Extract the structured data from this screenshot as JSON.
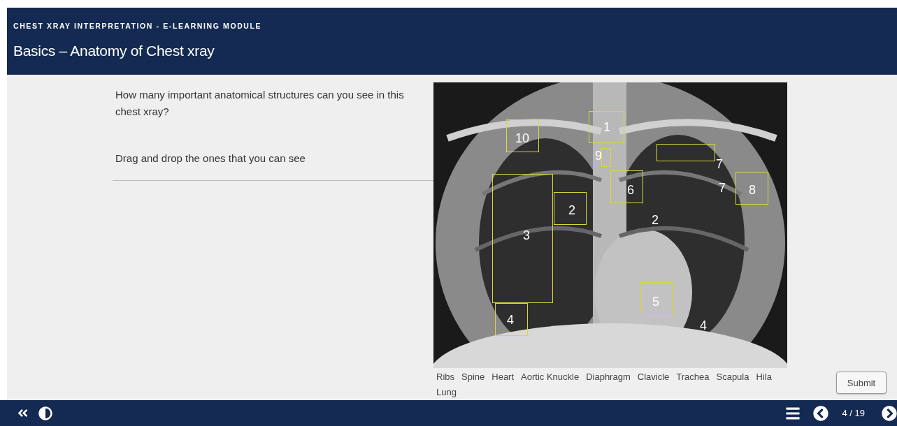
{
  "header": {
    "course_title": "CHEST XRAY INTERPRETATION - E-LEARNING MODULE",
    "slide_title": "Basics – Anatomy of Chest xray"
  },
  "question": {
    "prompt": "How many important anatomical structures can you see in this chest xray?",
    "instruction": "Drag and drop the ones that you can see"
  },
  "xray": {
    "kind": "picture",
    "markers": [
      "10",
      "1",
      "9",
      "7",
      "6",
      "7",
      "8",
      "2",
      "2",
      "3",
      "4",
      "5",
      "4"
    ]
  },
  "drag_items": [
    "Ribs",
    "Spine",
    "Heart",
    "Aortic Knuckle",
    "Diaphragm",
    "Clavicle",
    "Trachea",
    "Scapula",
    "Hila",
    "Lung"
  ],
  "submit_button": "Submit",
  "footer": {
    "page_indicator": "4 / 19"
  }
}
